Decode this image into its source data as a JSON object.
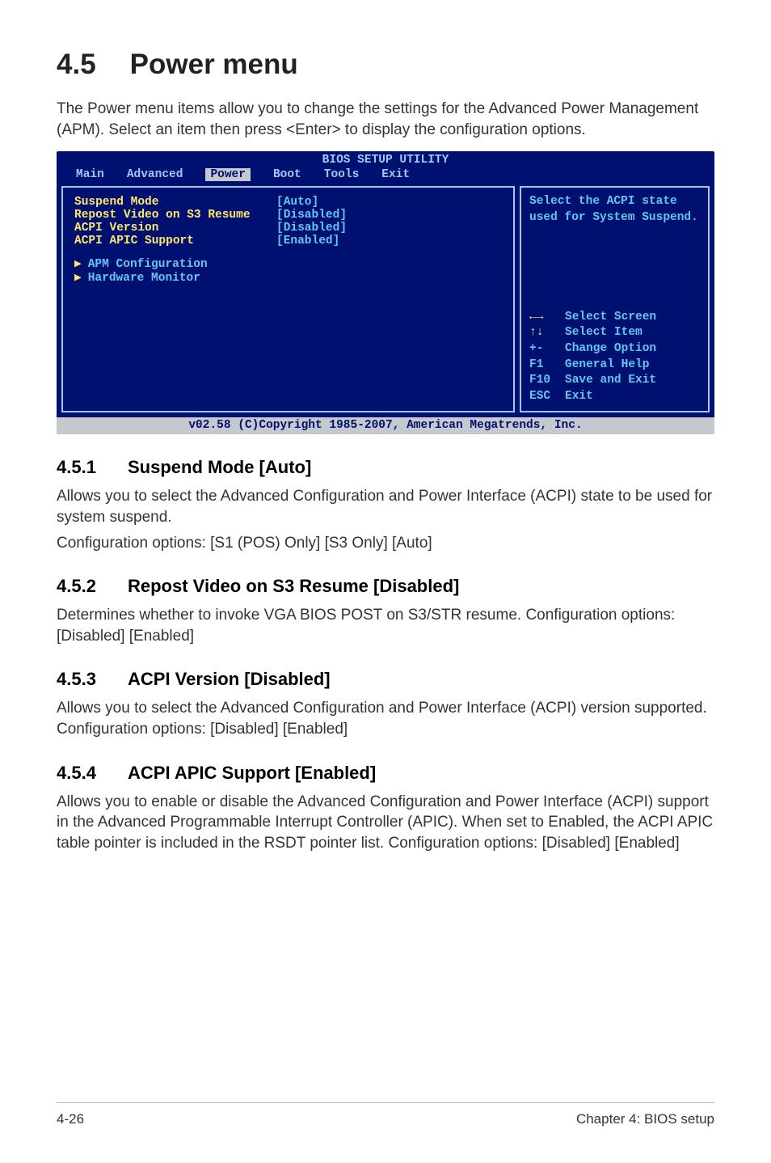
{
  "section": {
    "number": "4.5",
    "title": "Power menu",
    "intro": "The Power menu items allow you to change the settings for the Advanced Power Management (APM). Select an item then press <Enter> to display the configuration options."
  },
  "bios": {
    "title": "BIOS SETUP UTILITY",
    "tabs": [
      "Main",
      "Advanced",
      "Power",
      "Boot",
      "Tools",
      "Exit"
    ],
    "active_tab": "Power",
    "items": [
      {
        "label": "Suspend Mode",
        "value": "[Auto]"
      },
      {
        "label": "Repost Video on S3 Resume",
        "value": "[Disabled]"
      },
      {
        "label": "ACPI Version",
        "value": "[Disabled]"
      },
      {
        "label": "ACPI APIC Support",
        "value": "[Enabled]"
      }
    ],
    "submenus": [
      "APM Configuration",
      "Hardware Monitor"
    ],
    "help_top": "Select the ACPI state used for System Suspend.",
    "legend": [
      {
        "key": "←→",
        "desc": "Select Screen",
        "type": "arrow"
      },
      {
        "key": "↑↓",
        "desc": "Select Item",
        "type": "udarrow"
      },
      {
        "key": "+-",
        "desc": "Change Option",
        "type": "plain"
      },
      {
        "key": "F1",
        "desc": "General Help",
        "type": "plain"
      },
      {
        "key": "F10",
        "desc": "Save and Exit",
        "type": "plain"
      },
      {
        "key": "ESC",
        "desc": "Exit",
        "type": "plain"
      }
    ],
    "footer": "v02.58 (C)Copyright 1985-2007, American Megatrends, Inc."
  },
  "subsections": [
    {
      "num": "4.5.1",
      "title": "Suspend Mode [Auto]",
      "paras": [
        "Allows you to select the Advanced Configuration and Power Interface (ACPI) state to be used for system suspend.",
        "Configuration options: [S1 (POS) Only] [S3 Only] [Auto]"
      ]
    },
    {
      "num": "4.5.2",
      "title": "Repost Video on S3 Resume [Disabled]",
      "paras": [
        "Determines whether to invoke VGA BIOS POST on S3/STR resume. Configuration options: [Disabled] [Enabled]"
      ]
    },
    {
      "num": "4.5.3",
      "title": "ACPI Version [Disabled]",
      "paras": [
        "Allows you to select the Advanced Configuration and Power Interface (ACPI) version supported. Configuration options: [Disabled] [Enabled]"
      ]
    },
    {
      "num": "4.5.4",
      "title": "ACPI APIC Support [Enabled]",
      "paras": [
        "Allows you to enable or disable the Advanced Configuration and Power Interface (ACPI) support in the Advanced Programmable Interrupt Controller (APIC). When set to Enabled, the ACPI APIC table pointer is included in the RSDT pointer list. Configuration options: [Disabled] [Enabled]"
      ]
    }
  ],
  "footer": {
    "left": "4-26",
    "right": "Chapter 4: BIOS setup"
  }
}
